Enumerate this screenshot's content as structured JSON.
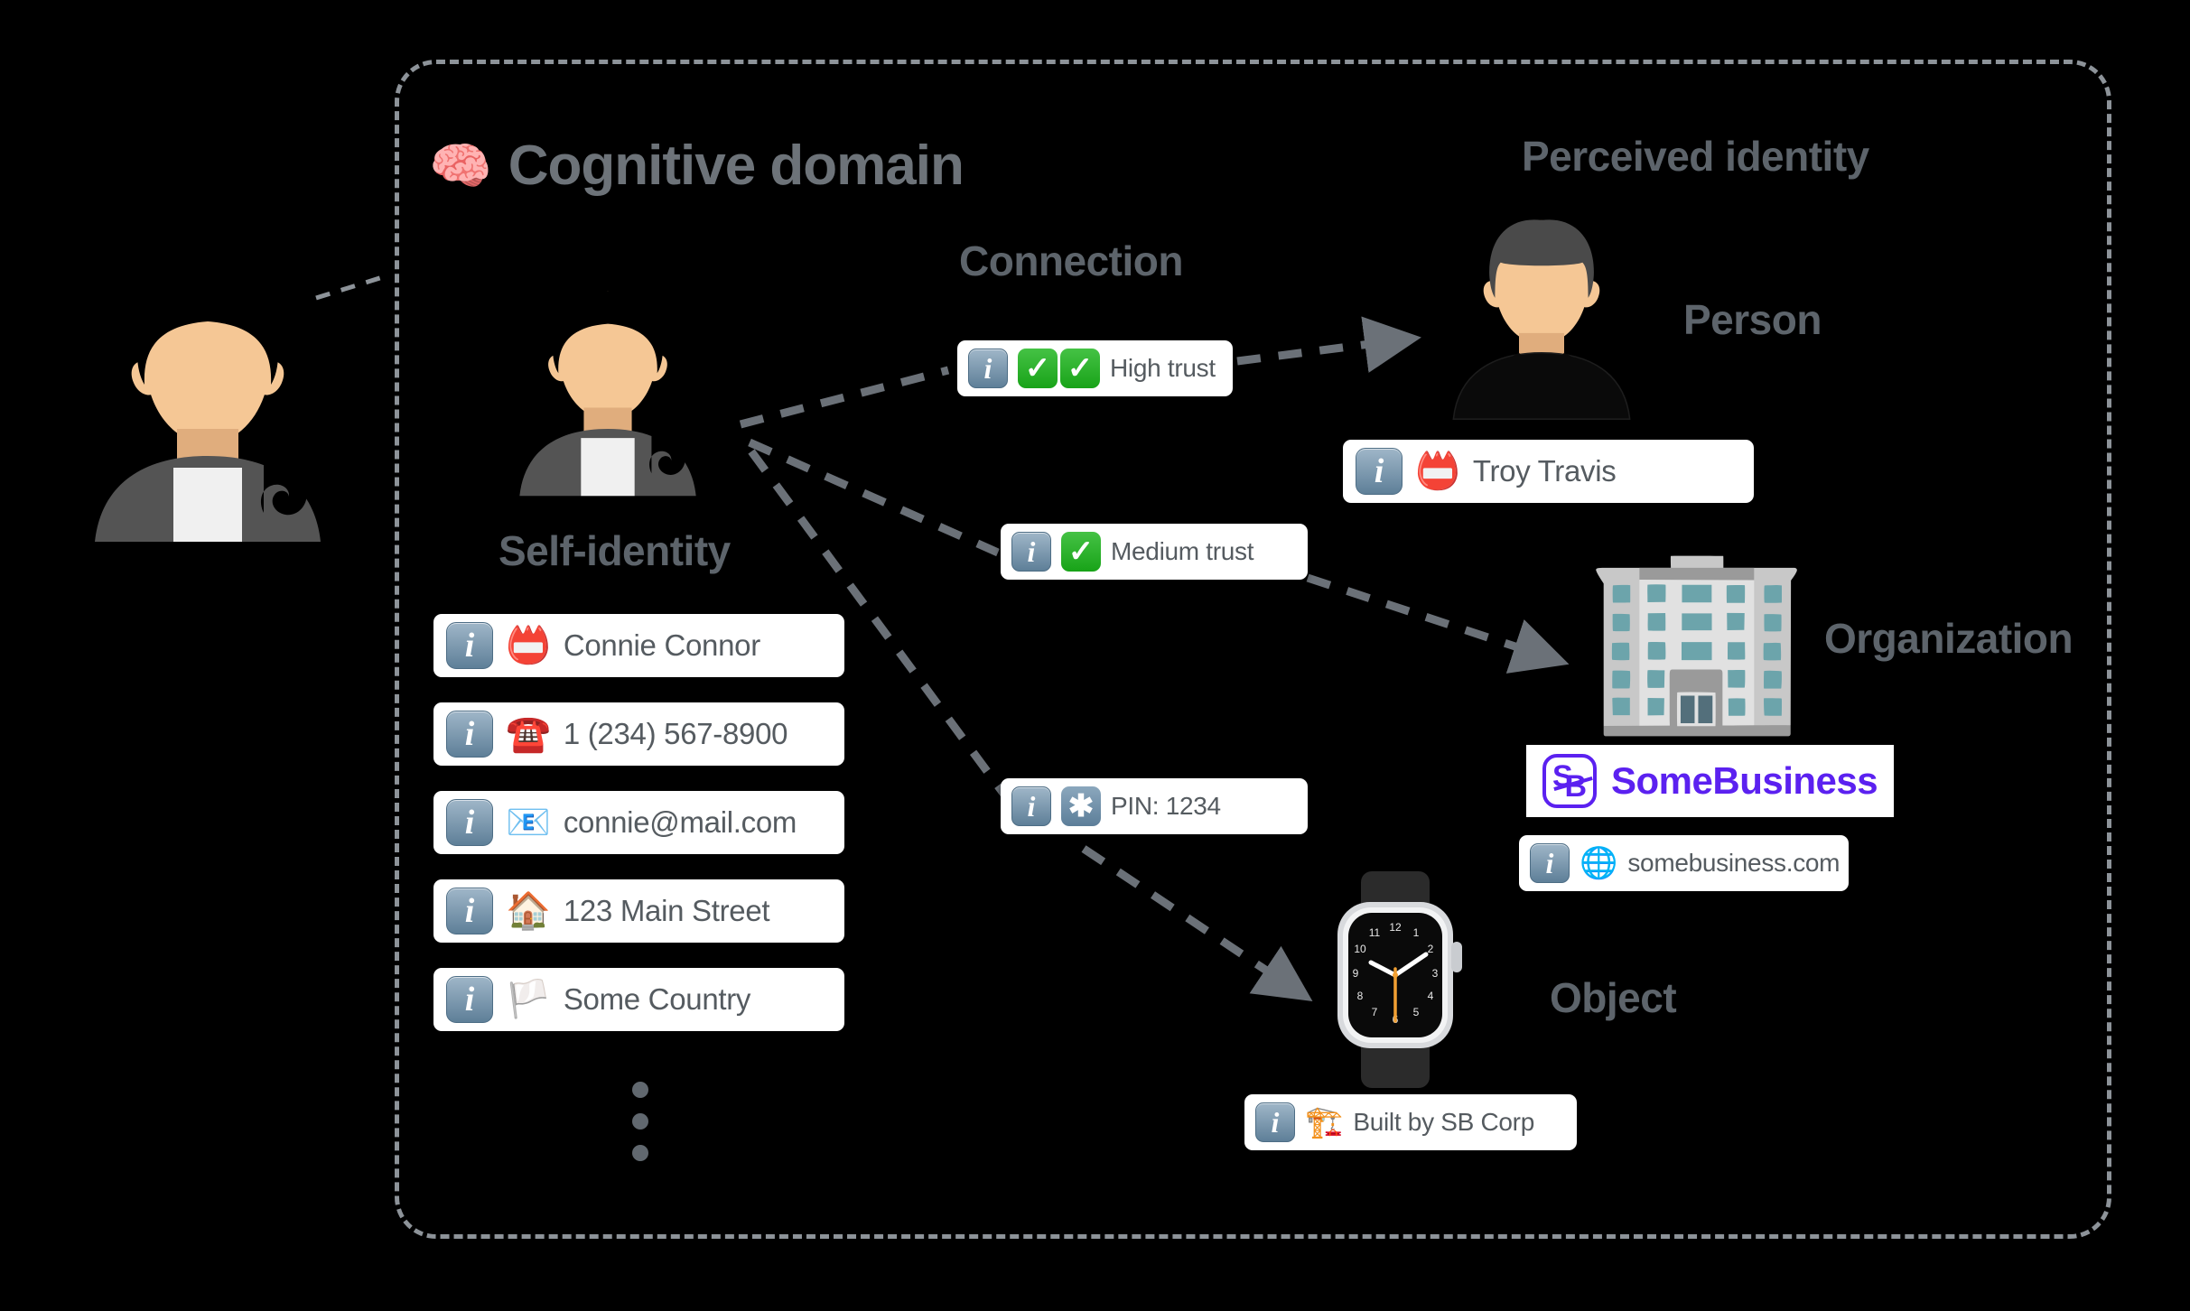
{
  "domain": {
    "title": "Cognitive domain",
    "brain_icon": "brain-emoji"
  },
  "labels": {
    "self_identity": "Self-identity",
    "connection": "Connection",
    "perceived_identity": "Perceived identity",
    "person": "Person",
    "organization": "Organization",
    "object": "Object"
  },
  "colors": {
    "background": "#000000",
    "label_gray": "#5d646b",
    "boundary_dashed": "#8d9399",
    "card_white": "#ffffff",
    "card_text": "#555b60",
    "brand_purple": "#5b21f0",
    "check_green": "#18a318",
    "info_blue": "#5e7f98",
    "skin": "#f5c795",
    "hair_gray": "#545454"
  },
  "self_identity_cards": [
    {
      "icon": "name-badge-emoji",
      "glyph": "📛",
      "text": "Connie Connor"
    },
    {
      "icon": "telephone-emoji",
      "glyph": "☎️",
      "text": "1 (234) 567-8900"
    },
    {
      "icon": "email-emoji",
      "glyph": "📧",
      "text": "connie@mail.com"
    },
    {
      "icon": "house-emoji",
      "glyph": "🏠",
      "text": "123 Main Street"
    },
    {
      "icon": "white-flag-emoji",
      "glyph": "🏳️",
      "text": "Some Country"
    }
  ],
  "connection_cards": [
    {
      "id": "high-trust",
      "text": "High trust",
      "checks": 2
    },
    {
      "id": "medium-trust",
      "text": "Medium trust",
      "checks": 1
    },
    {
      "id": "pin",
      "text": "PIN: 1234",
      "checks": 0
    }
  ],
  "person": {
    "card": {
      "icon": "name-badge-emoji",
      "glyph": "📛",
      "text": "Troy Travis"
    }
  },
  "organization": {
    "logo_name": "SomeBusiness",
    "logo_initials": {
      "first": "S",
      "second": "B"
    },
    "website_card": {
      "icon": "globe-emoji",
      "glyph": "🌐",
      "text": "somebusiness.com"
    }
  },
  "object": {
    "card": {
      "icon": "crane-emoji",
      "glyph": "🏗️",
      "text": "Built by SB Corp"
    },
    "device": "smartwatch"
  },
  "ellipsis": {
    "dots": 3
  }
}
